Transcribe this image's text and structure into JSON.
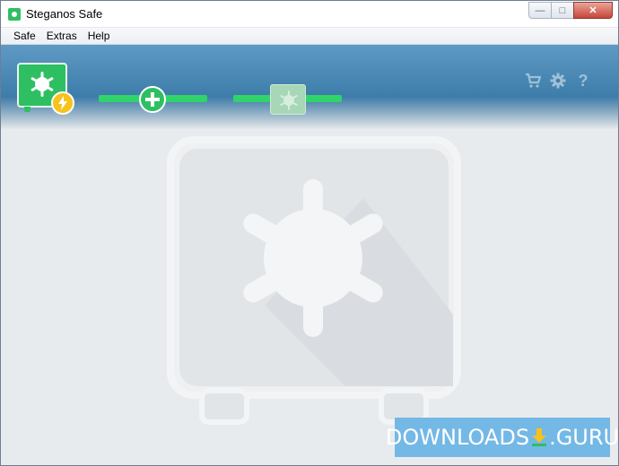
{
  "window": {
    "title": "Steganos Safe",
    "controls": {
      "minimize": "—",
      "maximize": "□",
      "close": "✕"
    }
  },
  "menu": {
    "items": [
      "Safe",
      "Extras",
      "Help"
    ]
  },
  "header": {
    "icons": [
      "cart-icon",
      "gear-icon",
      "help-icon"
    ],
    "icon_glyphs": {
      "cart": "🛒",
      "settings": "⚙",
      "help": "?"
    }
  },
  "watermark": {
    "text_left": "DOWNLOADS",
    "text_right": ".GURU"
  },
  "colors": {
    "accent_green": "#2fbf63",
    "header_blue": "#3f7eab",
    "bolt_yellow": "#f6c21b",
    "watermark_blue": "#74b8e6"
  }
}
